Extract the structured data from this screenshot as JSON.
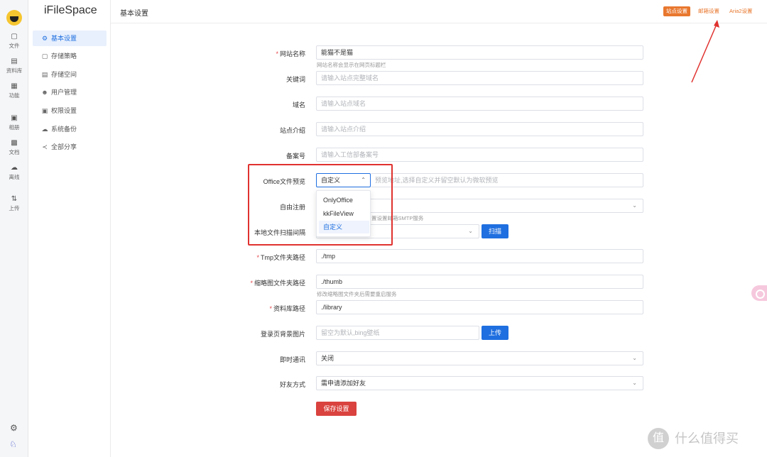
{
  "app_title": "iFileSpace",
  "rail": {
    "items": [
      {
        "icon": "file-icon",
        "label": "文件"
      },
      {
        "icon": "folder-icon",
        "label": "资料库"
      },
      {
        "icon": "grid-icon",
        "label": "功能"
      },
      {
        "icon": "image-icon",
        "label": "相册"
      },
      {
        "icon": "document-icon",
        "label": "文档"
      },
      {
        "icon": "cloud-download-icon",
        "label": "离线"
      },
      {
        "icon": "upload-arrows-icon",
        "label": "上传"
      }
    ]
  },
  "menu": {
    "items": [
      {
        "icon": "gear-icon",
        "label": "基本设置",
        "active": true
      },
      {
        "icon": "storage-policy-icon",
        "label": "存储策略"
      },
      {
        "icon": "storage-space-icon",
        "label": "存储空间"
      },
      {
        "icon": "user-icon",
        "label": "用户管理"
      },
      {
        "icon": "permission-icon",
        "label": "权限设置"
      },
      {
        "icon": "cloud-backup-icon",
        "label": "系统备份"
      },
      {
        "icon": "share-icon",
        "label": "全部分享"
      }
    ]
  },
  "header": {
    "title": "基本设置",
    "tabs": [
      {
        "label": "站点设置",
        "active": true
      },
      {
        "label": "邮箱设置"
      },
      {
        "label": "Aria2设置"
      }
    ]
  },
  "form": {
    "site_name": {
      "label": "网站名称",
      "required": true,
      "value": "能猫不是猫",
      "hint": "网站名称会显示在网页标题栏"
    },
    "keywords": {
      "label": "关键词",
      "placeholder": "请输入站点完整域名"
    },
    "domain": {
      "label": "域名",
      "placeholder": "请输入站点域名"
    },
    "intro": {
      "label": "站点介绍",
      "placeholder": "请输入站点介绍"
    },
    "icp": {
      "label": "备案号",
      "placeholder": "请输入工信部备案号"
    },
    "office_preview": {
      "label": "Office文件预览",
      "value": "自定义",
      "url_placeholder": "预览地址,选择自定义并留空默认为微软预览",
      "options": [
        "OnlyOffice",
        "kkFileView",
        "自定义"
      ],
      "selected_index": 2
    },
    "free_register": {
      "label": "自由注册",
      "hint_tail": "置设置邮箱SMTP服务"
    },
    "scan_interval": {
      "label": "本地文件扫描间隔",
      "button": "扫描"
    },
    "tmp_path": {
      "label": "Tmp文件夹路径",
      "required": true,
      "value": "./tmp"
    },
    "thumb_path": {
      "label": "缩略图文件夹路径",
      "required": true,
      "value": "./thumb",
      "hint": "修改缩略图文件夹后需要重启服务"
    },
    "library_path": {
      "label": "资料库路径",
      "required": true,
      "value": "./library"
    },
    "login_bg": {
      "label": "登录页背景图片",
      "placeholder": "留空为默认,bing壁纸",
      "button": "上传"
    },
    "im": {
      "label": "即时通讯",
      "value": "关闭"
    },
    "friend_mode": {
      "label": "好友方式",
      "value": "需申请添加好友"
    },
    "save_button": "保存设置"
  },
  "watermark": {
    "glyph": "值",
    "text": "什么值得买"
  },
  "colors": {
    "accent": "#1f6fe0",
    "orange": "#e8772e",
    "danger": "#d9423e",
    "annotation": "#e0322f"
  }
}
